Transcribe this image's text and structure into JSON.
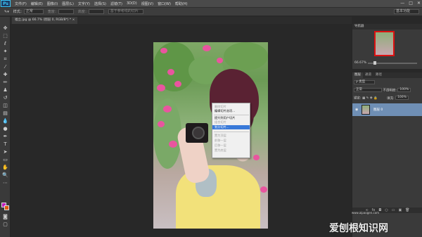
{
  "app": {
    "logo": "Ps"
  },
  "menubar": {
    "items": [
      "文件(F)",
      "编辑(E)",
      "图像(I)",
      "图层(L)",
      "文字(Y)",
      "选择(S)",
      "滤镜(T)",
      "3D(D)",
      "视图(V)",
      "窗口(W)",
      "帮助(H)"
    ],
    "window_controls": [
      "—",
      "□",
      "✕"
    ]
  },
  "optionsbar": {
    "style_label": "样式：",
    "style_value": "正常",
    "width_label": "宽度：",
    "height_label": "高度：",
    "refine_edge": "调整边缘...",
    "slice_button": "基于参考线的切片",
    "workspace": "基本功能"
  },
  "document": {
    "tab_title": "福立.jpg @ 66.7% (图层 0, RGB/8*) *",
    "tab_close": "×"
  },
  "context_menu": {
    "items": [
      {
        "label": "删除切片",
        "state": "disabled"
      },
      {
        "label": "编辑切片选项...",
        "state": "normal"
      },
      {
        "sep": true
      },
      {
        "label": "提升到用户切片",
        "state": "normal"
      },
      {
        "label": "组合切片",
        "state": "disabled"
      },
      {
        "label": "划分切片...",
        "state": "active"
      },
      {
        "sep": true
      },
      {
        "label": "置为顶层",
        "state": "disabled"
      },
      {
        "label": "前移一层",
        "state": "disabled"
      },
      {
        "label": "后移一层",
        "state": "disabled"
      },
      {
        "label": "置为底层",
        "state": "disabled"
      }
    ]
  },
  "navigator": {
    "title": "导航器",
    "zoom": "66.67%"
  },
  "layers": {
    "tabs": [
      "图层",
      "通道",
      "路径"
    ],
    "kind_label": "ρ 类型",
    "blend_mode": "正常",
    "opacity_label": "不透明度:",
    "opacity_value": "100%",
    "lock_label": "锁定:",
    "fill_label": "填充:",
    "fill_value": "100%",
    "layer_name": "图层 0",
    "footer_icons": [
      "∞",
      "fx",
      "◘",
      "○",
      "▭",
      "▣",
      "🗑"
    ]
  },
  "watermark": {
    "text": "爱刨根知识网",
    "url": "www.aipaogen.com"
  },
  "colors": {
    "foreground": "#c21fbe",
    "background": "#e35a12",
    "selection_highlight": "#3879d9",
    "layer_selected": "#6f8fb5"
  }
}
